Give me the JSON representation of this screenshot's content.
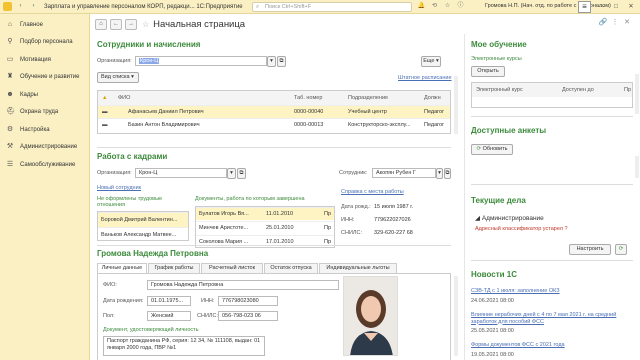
{
  "titlebar": {
    "title": "Зарплата и управление персоналом КОРП, редакци...  1С:Предприятие",
    "search_placeholder": "Поиск Ctrl+Shift+F",
    "user": "Громова Н.П. (Нач. отд. по работе с персоналом)"
  },
  "sidebar": {
    "items": [
      {
        "label": "Главное",
        "icon": "home-icon"
      },
      {
        "label": "Подбор персонала",
        "icon": "search-person-icon"
      },
      {
        "label": "Мотивация",
        "icon": "money-icon"
      },
      {
        "label": "Обучение и развитие",
        "icon": "education-icon"
      },
      {
        "label": "Кадры",
        "icon": "people-icon"
      },
      {
        "label": "Охрана труда",
        "icon": "safety-icon"
      },
      {
        "label": "Настройка",
        "icon": "settings-icon"
      },
      {
        "label": "Администрирование",
        "icon": "admin-icon"
      },
      {
        "label": "Самообслуживание",
        "icon": "self-service-icon"
      }
    ]
  },
  "page": {
    "title": "Начальная страница"
  },
  "employees": {
    "title": "Сотрудники и начисления",
    "org_label": "Организация:",
    "org_value": "Крон-Ц",
    "more_label": "Еще",
    "view_label": "Вид списка",
    "schedule_link": "Штатное расписание",
    "columns": [
      "ФИО",
      "Таб. номер",
      "Подразделение",
      "Должн"
    ],
    "rows": [
      {
        "name": "Афанасьев Даниил Петрович",
        "tab": "0000-00040",
        "dept": "Учебный центр",
        "pos": "Педагог"
      },
      {
        "name": "Базин Антон Владимирович",
        "tab": "0000-00013",
        "dept": "Конструкторско-эксплу...",
        "pos": "Педагог"
      }
    ]
  },
  "hr": {
    "title": "Работа с кадрами",
    "org_label": "Организация:",
    "org_value": "Крон-Ц",
    "employee_label": "Сотрудник:",
    "employee_value": "Акопян Рубен Г",
    "new_employee_link": "Новый сотрудник",
    "not_formalized": "Не оформлены трудовые отношения",
    "docs_label": "Документы, работа по которым завершена",
    "certificate_link": "Справка с места работы",
    "left_list": [
      "Боровой Дмитрий Валентин...",
      "Ваньков Александр Матвее..."
    ],
    "docs": [
      {
        "name": "Булатов Игорь Вя...",
        "date": "11.01.2010",
        "col": "Пр"
      },
      {
        "name": "Минчев Аристоте...",
        "date": "25.01.2010",
        "col": "Пр"
      },
      {
        "name": "Соколова Мария ...",
        "date": "17.01.2010",
        "col": "Пр"
      }
    ],
    "birth_label": "Дата рожд.:",
    "birth_value": "15 июля 1987 г.",
    "inn_label": "ИНН:",
    "inn_value": "779622027026",
    "snils_label": "СНИЛС:",
    "snils_value": "329-620-227 68"
  },
  "person": {
    "title": "Громова Надежда Петровна",
    "tabs": [
      "Личные данные",
      "График работы",
      "Расчетный листок",
      "Остаток отпуска",
      "Индивидуальные льготы"
    ],
    "fio_label": "ФИО:",
    "fio_value": "Громова Надежда Петровна",
    "birth_label": "Дата рождения:",
    "birth_value": "01.01.1975...",
    "inn_label": "ИНН:",
    "inn_value": "776798023080",
    "sex_label": "Пол:",
    "sex_value": "Женский",
    "snils_label": "СНИЛС:",
    "snils_value": "056-798-023 06",
    "doc_label": "Документ, удостоверяющий личность",
    "doc_value": "Паспорт гражданина РФ, серия: 12 34, № 111108, выдан: 01 января 2000 года, ПВР №1"
  },
  "learning": {
    "title": "Мое обучение",
    "courses_label": "Электронные курсы",
    "open_button": "Открыть",
    "columns": [
      "Электронный курс",
      "Доступен до",
      "Пр"
    ]
  },
  "surveys": {
    "title": "Доступные анкеты",
    "refresh_button": "Обновить"
  },
  "tasks": {
    "title": "Текущие дела",
    "group": "Администрирование",
    "item": "Адресный классификатор устарел",
    "configure_button": "Настроить"
  },
  "news": {
    "title": "Новости 1С",
    "items": [
      {
        "text": "СЗВ-ТД с 1 июля: заполнение ОКЗ",
        "date": "24.06.2021 08:00"
      },
      {
        "text": "Влияние нерабочих дней с 4 по 7 мая 2021 г. на средний заработок для пособий ФСС",
        "date": "25.05.2021 08:00"
      },
      {
        "text": "Формы документов ФСС с 2021 года",
        "date": "19.05.2021 08:00"
      }
    ]
  }
}
